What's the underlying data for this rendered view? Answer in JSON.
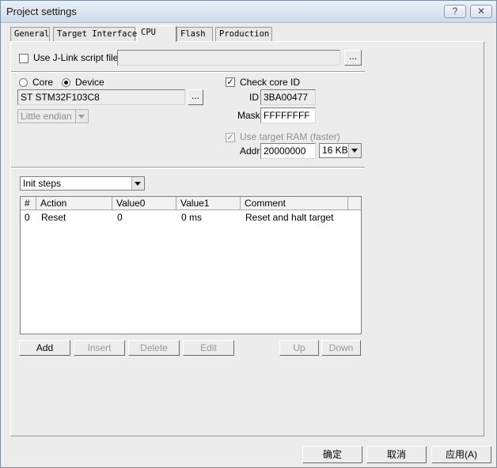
{
  "window": {
    "title": "Project settings",
    "help_label": "?",
    "close_label": "✕"
  },
  "tabs": [
    {
      "label": "General"
    },
    {
      "label": "Target Interface"
    },
    {
      "label": "CPU"
    },
    {
      "label": "Flash"
    },
    {
      "label": "Production"
    }
  ],
  "script": {
    "checkbox_label": "Use J-Link script file",
    "path_value": "",
    "browse_label": "..."
  },
  "device": {
    "core_label": "Core",
    "device_label": "Device",
    "device_value": "ST STM32F103C8",
    "browse_label": "...",
    "endian_value": "Little endian"
  },
  "core_id": {
    "checkbox_label": "Check core ID",
    "checkmark": "✓",
    "id_label": "ID",
    "id_value": "3BA00477",
    "mask_label": "Mask",
    "mask_value": "FFFFFFFF"
  },
  "ram": {
    "checkbox_label": "Use target RAM (faster)",
    "checkmark": "✓",
    "addr_label": "Addr",
    "addr_value": "20000000",
    "size_value": "16 KB"
  },
  "steps": {
    "selector_value": "Init steps",
    "columns": [
      "#",
      "Action",
      "Value0",
      "Value1",
      "Comment"
    ],
    "rows": [
      {
        "num": "0",
        "action": "Reset",
        "value0": "0",
        "value1": "0 ms",
        "comment": "Reset and halt target"
      }
    ],
    "buttons": {
      "add": "Add",
      "insert": "Insert",
      "delete": "Delete",
      "edit": "Edit",
      "up": "Up",
      "down": "Down"
    }
  },
  "dialog_buttons": {
    "ok": "确定",
    "cancel": "取消",
    "apply": "应用(A)"
  }
}
